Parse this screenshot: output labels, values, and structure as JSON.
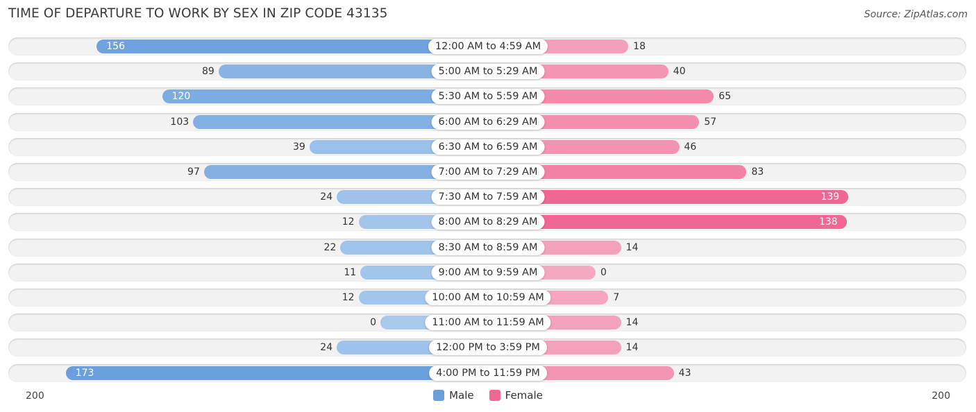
{
  "header": {
    "title": "TIME OF DEPARTURE TO WORK BY SEX IN ZIP CODE 43135",
    "source": "Source: ZipAtlas.com"
  },
  "colors": {
    "male_strong": "#6a9fdb",
    "male_light": "#a8c8ec",
    "female_strong": "#f06792",
    "female_light": "#f5a9c0"
  },
  "chart_data": {
    "type": "bar",
    "orientation": "horizontal-diverging",
    "title": "TIME OF DEPARTURE TO WORK BY SEX IN ZIP CODE 43135",
    "categories": [
      "12:00 AM to 4:59 AM",
      "5:00 AM to 5:29 AM",
      "5:30 AM to 5:59 AM",
      "6:00 AM to 6:29 AM",
      "6:30 AM to 6:59 AM",
      "7:00 AM to 7:29 AM",
      "7:30 AM to 7:59 AM",
      "8:00 AM to 8:29 AM",
      "8:30 AM to 8:59 AM",
      "9:00 AM to 9:59 AM",
      "10:00 AM to 10:59 AM",
      "11:00 AM to 11:59 AM",
      "12:00 PM to 3:59 PM",
      "4:00 PM to 11:59 PM"
    ],
    "series": [
      {
        "name": "Male",
        "side": "left",
        "values": [
          156,
          89,
          120,
          103,
          39,
          97,
          24,
          12,
          22,
          11,
          12,
          0,
          24,
          173
        ]
      },
      {
        "name": "Female",
        "side": "right",
        "values": [
          18,
          40,
          65,
          57,
          46,
          83,
          139,
          138,
          14,
          0,
          7,
          14,
          14,
          43
        ]
      }
    ],
    "xlim": [
      200,
      200
    ],
    "axis_labels": {
      "left": "200",
      "right": "200"
    },
    "legend": {
      "position": "bottom-center",
      "entries": [
        "Male",
        "Female"
      ]
    },
    "grid": false
  }
}
